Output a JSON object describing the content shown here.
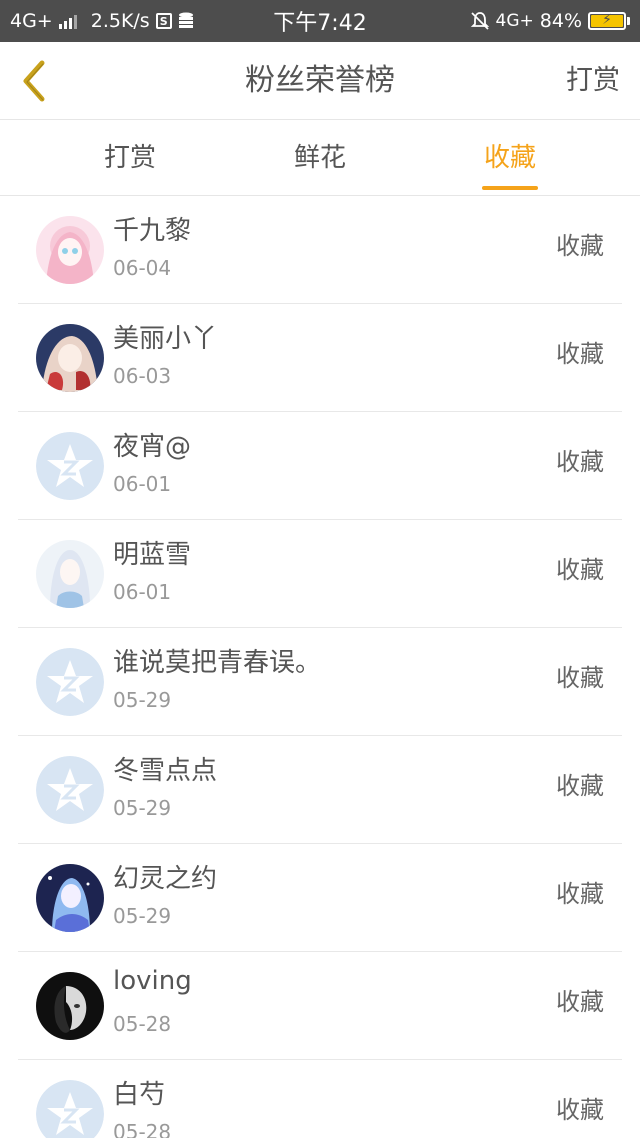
{
  "status_bar": {
    "network": "4G+",
    "speed": "2.5K/s",
    "s_badge": "S",
    "time": "下午7:42",
    "network_right": "4G+",
    "battery": "84%",
    "icons": [
      "signal-icon",
      "s-badge-icon",
      "database-icon",
      "mute-bell-icon",
      "battery-icon"
    ]
  },
  "header": {
    "title": "粉丝荣誉榜",
    "action_label": "打赏",
    "back_icon": "chevron-left-icon",
    "accent_color": "#c9a21c"
  },
  "tabs": [
    {
      "label": "打赏",
      "active": false
    },
    {
      "label": "鲜花",
      "active": false
    },
    {
      "label": "收藏",
      "active": true
    }
  ],
  "accent_color": "#f5a31a",
  "fans": [
    {
      "name": "千九黎",
      "date": "06-04",
      "action": "收藏",
      "avatar": "anime-girl-pink-avatar"
    },
    {
      "name": "美丽小丫",
      "date": "06-03",
      "action": "收藏",
      "avatar": "anime-girl-red-avatar"
    },
    {
      "name": "夜宵@",
      "date": "06-01",
      "action": "收藏",
      "avatar": "default-qq-avatar"
    },
    {
      "name": "明蓝雪",
      "date": "06-01",
      "action": "收藏",
      "avatar": "anime-girl-white-avatar"
    },
    {
      "name": "谁说莫把青春误。",
      "date": "05-29",
      "action": "收藏",
      "avatar": "default-qq-avatar"
    },
    {
      "name": "冬雪点点",
      "date": "05-29",
      "action": "收藏",
      "avatar": "default-qq-avatar"
    },
    {
      "name": "幻灵之约",
      "date": "05-29",
      "action": "收藏",
      "avatar": "anime-girl-blue-avatar"
    },
    {
      "name": "loving",
      "date": "05-28",
      "action": "收藏",
      "avatar": "bw-portrait-avatar"
    },
    {
      "name": "白芍",
      "date": "05-28",
      "action": "收藏",
      "avatar": "default-qq-avatar"
    }
  ]
}
